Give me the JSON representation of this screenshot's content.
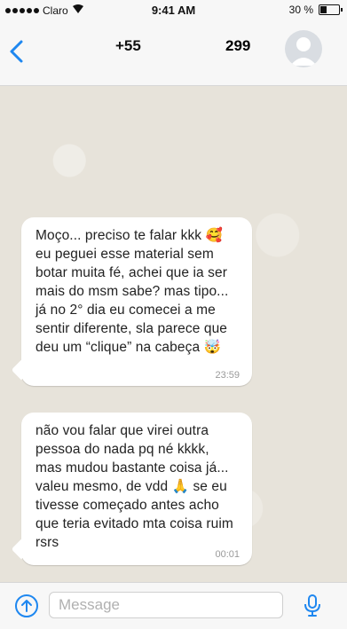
{
  "status_bar": {
    "carrier": "Claro",
    "time": "9:41 AM",
    "battery": "30 %"
  },
  "header": {
    "contact_prefix": "+55",
    "contact_suffix": "299"
  },
  "messages": [
    {
      "text": "Moço... preciso te falar kkk 🥰 eu peguei esse material sem botar muita fé, achei que ia ser mais do msm sabe? mas tipo... já no 2° dia eu comecei a me sentir diferente, sla parece que deu um “clique” na cabeça 🤯",
      "time": "23:59"
    },
    {
      "text": "não vou falar que virei outra pessoa do nada pq né kkkk, mas mudou bastante coisa já... valeu mesmo, de vdd 🙏 se eu tivesse começado antes acho que teria evitado mta coisa ruim rsrs",
      "time": "00:01"
    }
  ],
  "composer": {
    "placeholder": "Message"
  },
  "colors": {
    "accent": "#1e87f0",
    "bubble": "#ffffff",
    "chat_bg": "#e7e3da"
  }
}
